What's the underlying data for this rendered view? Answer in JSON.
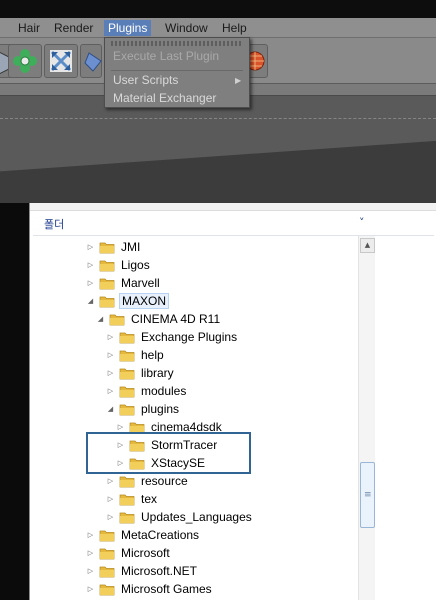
{
  "menubar": {
    "items": [
      "Hair",
      "Render",
      "Plugins",
      "Window",
      "Help"
    ],
    "active": "Plugins"
  },
  "plugins_menu": {
    "items": [
      {
        "label": "Execute Last Plugin",
        "enabled": false
      },
      {
        "label": "User Scripts",
        "submenu": true
      },
      {
        "label": "Material Exchanger"
      }
    ]
  },
  "toolbar": {
    "icons": [
      "cube-icon",
      "flower-generator-icon",
      "arrows-expand-icon",
      "blue-shape-icon",
      "render-globe-icon"
    ]
  },
  "folder_panel": {
    "header": "폴더",
    "header_chevron": "˅"
  },
  "tree": {
    "items": [
      {
        "label": "JMI",
        "level": 0,
        "expanded": false
      },
      {
        "label": "Ligos",
        "level": 0,
        "expanded": false
      },
      {
        "label": "Marvell",
        "level": 0,
        "expanded": false
      },
      {
        "label": "MAXON",
        "level": 0,
        "expanded": true,
        "selected": true
      },
      {
        "label": "CINEMA 4D R11",
        "level": 1,
        "expanded": true
      },
      {
        "label": "Exchange Plugins",
        "level": 2,
        "expanded": false
      },
      {
        "label": "help",
        "level": 2,
        "expanded": false
      },
      {
        "label": "library",
        "level": 2,
        "expanded": false
      },
      {
        "label": "modules",
        "level": 2,
        "expanded": false
      },
      {
        "label": "plugins",
        "level": 2,
        "expanded": true
      },
      {
        "label": "cinema4dsdk",
        "level": 3,
        "expanded": false
      },
      {
        "label": "StormTracer",
        "level": 3,
        "expanded": false,
        "highlighted": true
      },
      {
        "label": "XStacySE",
        "level": 3,
        "expanded": false,
        "highlighted": true
      },
      {
        "label": "resource",
        "level": 2,
        "expanded": false
      },
      {
        "label": "tex",
        "level": 2,
        "expanded": false
      },
      {
        "label": "Updates_Languages",
        "level": 2,
        "expanded": false
      },
      {
        "label": "MetaCreations",
        "level": 0,
        "expanded": false
      },
      {
        "label": "Microsoft",
        "level": 0,
        "expanded": false
      },
      {
        "label": "Microsoft.NET",
        "level": 0,
        "expanded": false
      },
      {
        "label": "Microsoft Games",
        "level": 0,
        "expanded": false
      }
    ]
  },
  "colors": {
    "menu_active": "#5a7fb8",
    "highlight_box": "#2f6495",
    "folder_yellow": "#f2cf5b"
  }
}
